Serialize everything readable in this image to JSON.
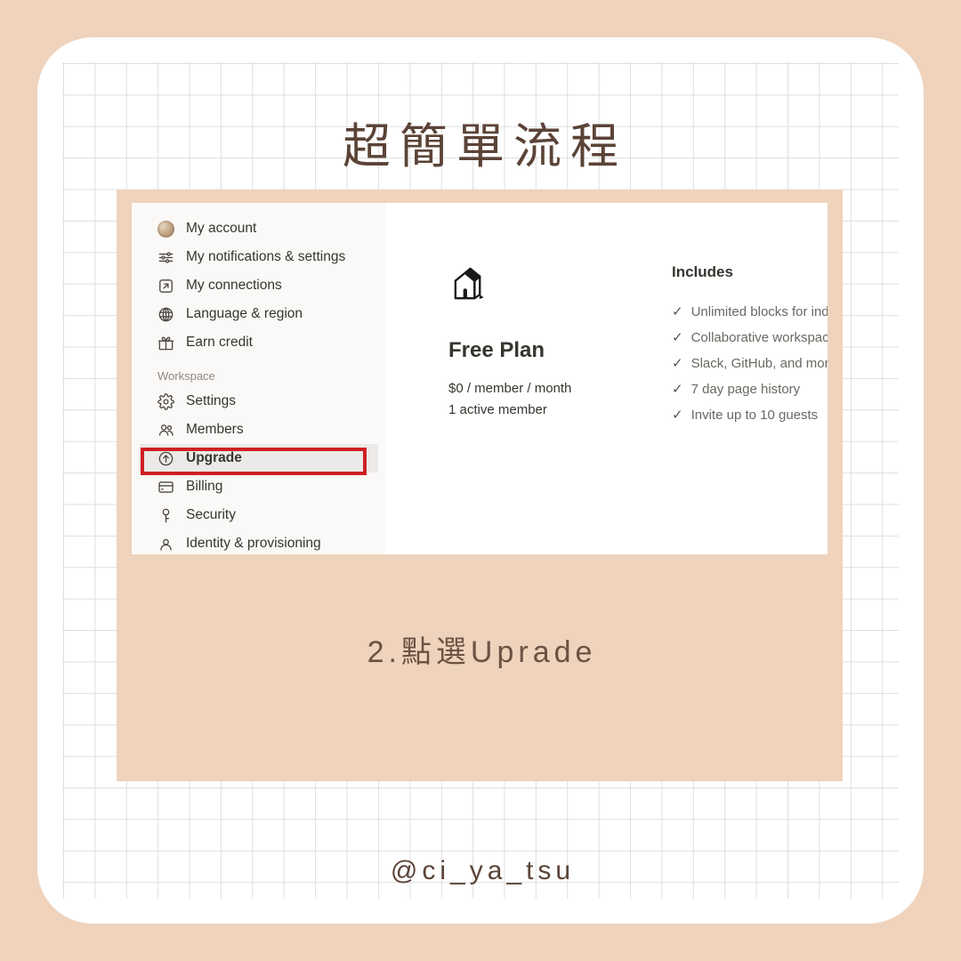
{
  "headline": "超簡單流程",
  "caption": "2.點選Uprade",
  "handle": "@ci_ya_tsu",
  "colors": {
    "outer_background": "#efd3bc",
    "paper_card": "#ffffff",
    "grid_line": "#d9d9d9",
    "headline_text": "#5b4337",
    "caption_text": "#6b5344",
    "highlight_border": "#cf1f22",
    "sidebar_background": "#fbf9f8",
    "selected_row": "#ebeae8",
    "primary_text": "#37352f",
    "muted_text": "#6b6862"
  },
  "screenshot": {
    "sidebar": {
      "account_items": [
        {
          "icon": "avatar-icon",
          "label": "My account"
        },
        {
          "icon": "sliders-icon",
          "label": "My notifications & settings"
        },
        {
          "icon": "arrow-out-box-icon",
          "label": "My connections"
        },
        {
          "icon": "globe-icon",
          "label": "Language & region"
        },
        {
          "icon": "gift-icon",
          "label": "Earn credit"
        }
      ],
      "section_label": "Workspace",
      "workspace_items": [
        {
          "icon": "gear-icon",
          "label": "Settings",
          "selected": false
        },
        {
          "icon": "people-icon",
          "label": "Members",
          "selected": false
        },
        {
          "icon": "arrow-up-circle-icon",
          "label": "Upgrade",
          "selected": true
        },
        {
          "icon": "credit-card-icon",
          "label": "Billing",
          "selected": false
        },
        {
          "icon": "key-icon",
          "label": "Security",
          "selected": false
        },
        {
          "icon": "identity-icon",
          "label": "Identity & provisioning",
          "selected": false
        }
      ]
    },
    "plan": {
      "icon": "house-icon",
      "title": "Free Plan",
      "price": "$0 / member / month",
      "members": "1 active member"
    },
    "includes": {
      "title": "Includes",
      "check_glyph": "✓",
      "features": [
        "Unlimited blocks for ind",
        "Collaborative workspace",
        "Slack, GitHub, and more",
        "7 day page history",
        "Invite up to 10 guests"
      ]
    }
  }
}
